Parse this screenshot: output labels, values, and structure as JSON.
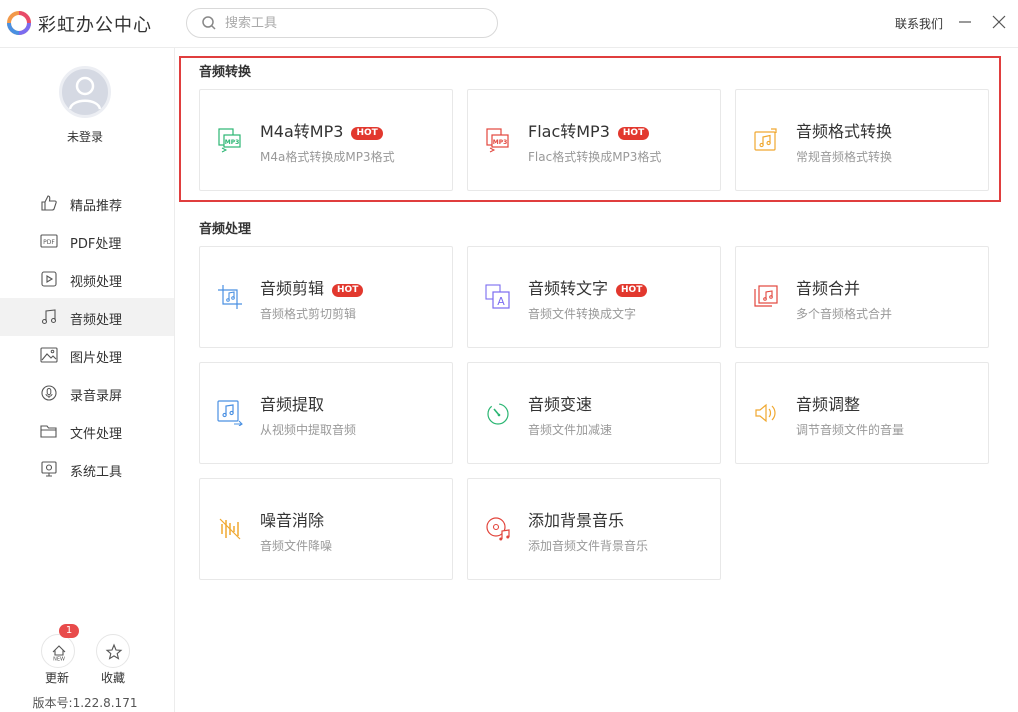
{
  "app": {
    "title": "彩虹办公中心"
  },
  "search": {
    "placeholder": "搜索工具"
  },
  "header": {
    "contact_label": "联系我们"
  },
  "user": {
    "status": "未登录"
  },
  "sidebar": {
    "items": [
      {
        "label": "精品推荐",
        "icon": "thumbs-up-icon"
      },
      {
        "label": "PDF处理",
        "icon": "pdf-icon"
      },
      {
        "label": "视频处理",
        "icon": "video-icon"
      },
      {
        "label": "音频处理",
        "icon": "music-note-icon",
        "active": true
      },
      {
        "label": "图片处理",
        "icon": "image-icon"
      },
      {
        "label": "录音录屏",
        "icon": "record-icon"
      },
      {
        "label": "文件处理",
        "icon": "folder-icon"
      },
      {
        "label": "系统工具",
        "icon": "system-tool-icon"
      }
    ],
    "update_label": "更新",
    "update_badge": "1",
    "favorite_label": "收藏",
    "version": "版本号:1.22.8.171"
  },
  "sections": [
    {
      "title": "音频转换",
      "cards": [
        {
          "title": "M4a转MP3",
          "hot": "HOT",
          "desc": "M4a格式转换成MP3格式",
          "icon": "m4a-to-mp3-icon",
          "color": "#2bb673"
        },
        {
          "title": "Flac转MP3",
          "hot": "HOT",
          "desc": "Flac格式转换成MP3格式",
          "icon": "flac-to-mp3-icon",
          "color": "#e2453c"
        },
        {
          "title": "音频格式转换",
          "hot": "",
          "desc": "常规音频格式转换",
          "icon": "audio-format-convert-icon",
          "color": "#f0a830"
        }
      ]
    },
    {
      "title": "音频处理",
      "cards": [
        {
          "title": "音频剪辑",
          "hot": "HOT",
          "desc": "音频格式剪切剪辑",
          "icon": "audio-cut-icon",
          "color": "#4a90e2"
        },
        {
          "title": "音频转文字",
          "hot": "HOT",
          "desc": "音频文件转换成文字",
          "icon": "audio-to-text-icon",
          "color": "#7b6cf0"
        },
        {
          "title": "音频合并",
          "hot": "",
          "desc": "多个音频格式合并",
          "icon": "audio-merge-icon",
          "color": "#e2453c"
        },
        {
          "title": "音频提取",
          "hot": "",
          "desc": "从视频中提取音频",
          "icon": "audio-extract-icon",
          "color": "#4a90e2"
        },
        {
          "title": "音频变速",
          "hot": "",
          "desc": "音频文件加减速",
          "icon": "audio-speed-icon",
          "color": "#2bb673"
        },
        {
          "title": "音频调整",
          "hot": "",
          "desc": "调节音频文件的音量",
          "icon": "volume-icon",
          "color": "#f0a830"
        },
        {
          "title": "噪音消除",
          "hot": "",
          "desc": "音频文件降噪",
          "icon": "noise-reduction-icon",
          "color": "#f0a830"
        },
        {
          "title": "添加背景音乐",
          "hot": "",
          "desc": "添加音频文件背景音乐",
          "icon": "background-music-icon",
          "color": "#e2453c"
        }
      ]
    }
  ]
}
